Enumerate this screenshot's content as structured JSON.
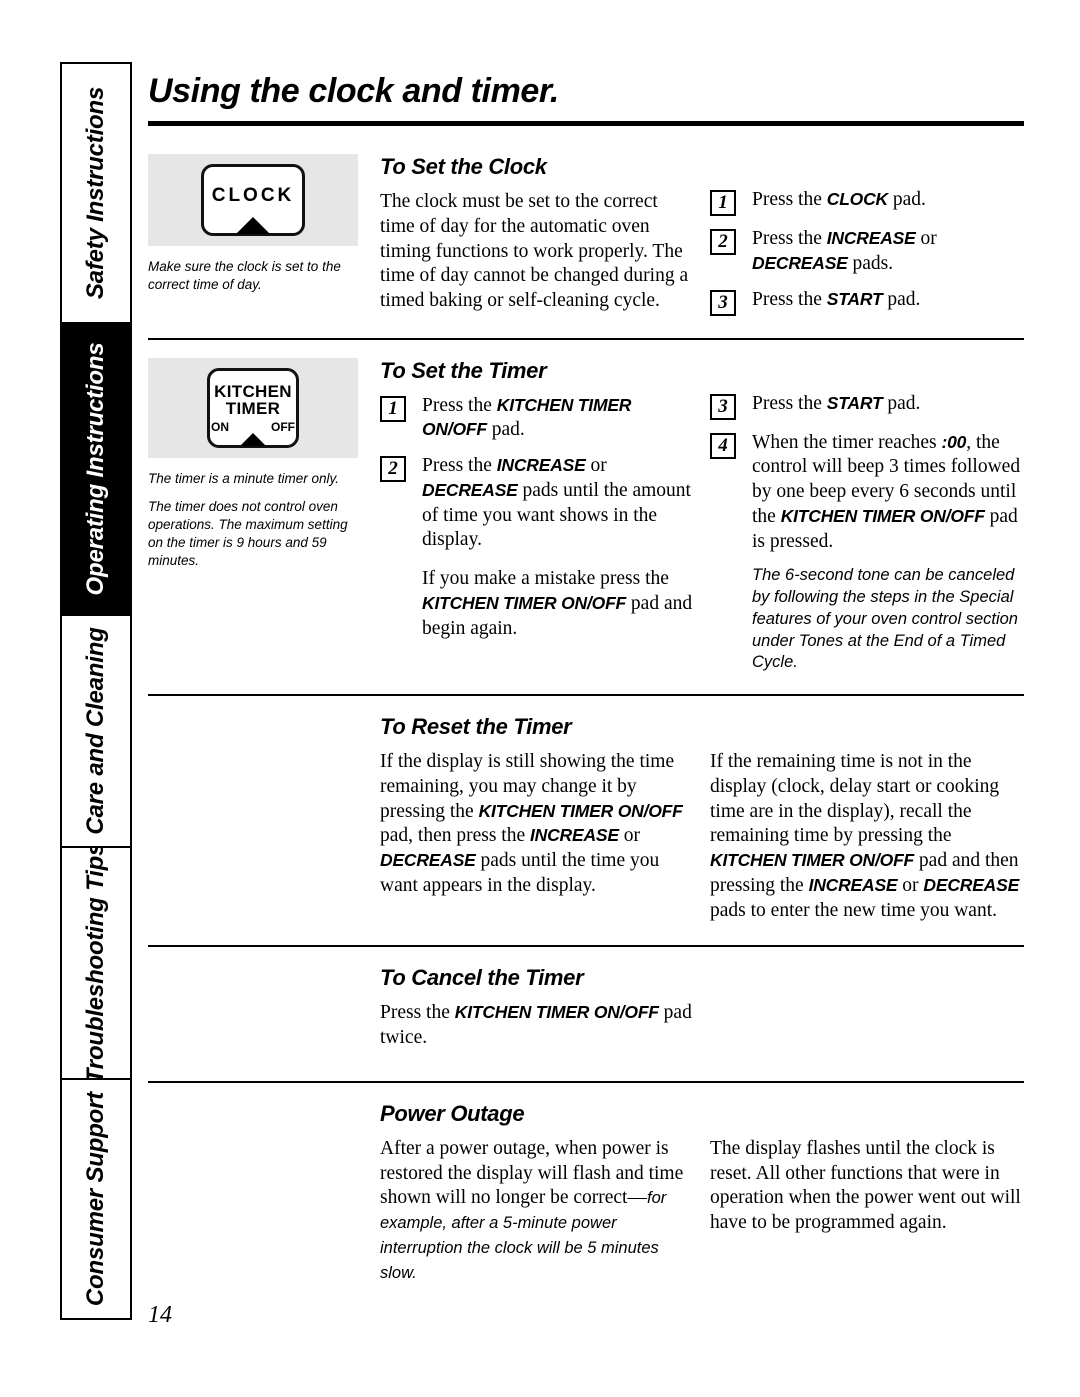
{
  "document": {
    "page_title": "Using the clock and timer.",
    "page_number": "14"
  },
  "sidebar": {
    "tabs": [
      {
        "label": "Safety Instructions",
        "active": false
      },
      {
        "label": "Operating Instructions",
        "active": true
      },
      {
        "label": "Care and Cleaning",
        "active": false
      },
      {
        "label": "Troubleshooting Tips",
        "active": false
      },
      {
        "label": "Consumer Support",
        "active": false
      }
    ]
  },
  "illustrations": {
    "clock_pad": {
      "label": "CLOCK",
      "caption": "Make sure the clock is set to the correct time of day."
    },
    "timer_pad": {
      "line1": "KITCHEN",
      "line2": "TIMER",
      "on": "ON",
      "off": "OFF",
      "caption1": "The timer is a minute timer only.",
      "caption2": "The timer does not control oven operations. The maximum setting on the timer is 9 hours and 59 minutes."
    }
  },
  "sections": {
    "set_clock": {
      "heading": "To Set the Clock",
      "body": "The clock must be set to the correct time of day for the automatic oven timing functions to work properly. The time of day cannot be changed during a timed baking or self-cleaning cycle.",
      "steps": [
        {
          "num": "1",
          "pre": "Press the ",
          "kw": "CLOCK",
          "post": " pad."
        },
        {
          "num": "2",
          "pre": "Press the ",
          "kw": "INCREASE",
          "mid": " or ",
          "kw2": "DECREASE",
          "post": " pads."
        },
        {
          "num": "3",
          "pre": "Press the ",
          "kw": "START",
          "post": " pad."
        }
      ]
    },
    "set_timer": {
      "heading": "To Set the Timer",
      "steps_left": [
        {
          "num": "1",
          "pre": "Press the ",
          "kw": "KITCHEN TIMER ON/OFF",
          "post": " pad."
        },
        {
          "num": "2",
          "pre": "Press the ",
          "kw": "INCREASE",
          "mid": " or ",
          "kw2": "DECREASE",
          "post": " pads until the amount of time you want shows in the display."
        }
      ],
      "mistake_pre": "If you make a mistake press the ",
      "mistake_kw": "KITCHEN TIMER ON/OFF",
      "mistake_post": " pad and begin again.",
      "steps_right": [
        {
          "num": "3",
          "pre": "Press the ",
          "kw": "START",
          "post": " pad."
        },
        {
          "num": "4",
          "pre": "When the timer reaches ",
          "kw": ":00",
          "mid": ", the control will beep 3 times followed by one beep every 6 seconds until the ",
          "kw2": "KITCHEN TIMER ON/OFF",
          "post": " pad is pressed."
        }
      ],
      "note": "The 6-second tone can be canceled by following the steps in the Special features of your oven control section under Tones at the End of a Timed Cycle."
    },
    "reset_timer": {
      "heading": "To Reset the Timer",
      "left_p1": "If the display is still showing the time remaining, you may change it by pressing the ",
      "left_kw1": "KITCHEN TIMER ON/OFF",
      "left_p2": " pad, then press the ",
      "left_kw2": "INCREASE",
      "left_p3": " or ",
      "left_kw3": "DECREASE",
      "left_p4": " pads until the time you want appears in the display.",
      "right_p1": "If the remaining time is not in the display (clock, delay start or cooking time are in the display), recall the remaining time by pressing the ",
      "right_kw1": "KITCHEN TIMER ON/OFF",
      "right_p2": " pad and then pressing the ",
      "right_kw2": "INCREASE",
      "right_p3": " or ",
      "right_kw3": "DECREASE",
      "right_p4": " pads to enter the new time you want."
    },
    "cancel_timer": {
      "heading": "To Cancel the Timer",
      "pre": "Press the ",
      "kw": "KITCHEN TIMER ON/OFF",
      "post": " pad twice."
    },
    "power_outage": {
      "heading": "Power Outage",
      "left_serif": "After a power outage, when power is restored the display will flash and time shown will no longer be correct—",
      "left_italic": "for example, after a 5-minute power interruption the clock will be 5 minutes slow.",
      "right": "The display flashes until the clock is reset. All other functions that were in operation when the power went out will have to be programmed again."
    }
  }
}
